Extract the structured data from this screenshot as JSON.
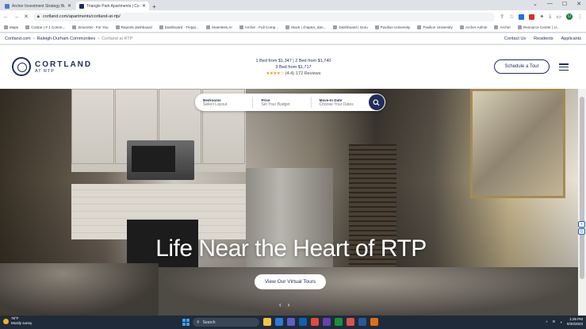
{
  "browser": {
    "tabs": [
      {
        "title": "Archer Investment Strategy Build",
        "fav": "#4a7bd0",
        "active": false
      },
      {
        "title": "Triangle Park Apartments | Cort",
        "fav": "#1f2d5c",
        "active": true
      }
    ],
    "new_tab_glyph": "+",
    "url": "cortland.com/apartments/cortland-at-rtp/",
    "profile_initial": "U"
  },
  "bookmarks": [
    "Maps",
    "CoStar | # 1 Comm...",
    "SiriusXM - For You",
    "Reports dashboard",
    "Dashboard - Treppi...",
    "Seamless.AI",
    "Archer - Full Comp...",
    "Slack | chapter_dan...",
    "Dashboard | Guru",
    "Pavilion University",
    "Pavilion University",
    "Archer Admin",
    "Archer",
    "Resource Center | U..."
  ],
  "site_nav": {
    "crumbs": [
      "Cortland.com",
      "Raleigh-Durham Communities",
      "Cortland at RTP"
    ],
    "links": [
      "Contact Us",
      "Residents",
      "Applicants"
    ]
  },
  "header": {
    "brand": "CORTLAND",
    "sub": "AT RTP",
    "pricing_line1": "1 Bed from $1,347  |  2 Bed from $1,740",
    "pricing_line2": "3 Bed from $1,717",
    "rating": "(4.4)",
    "reviews": "172 Reviews",
    "stars": "★★★★☆",
    "tour_button": "Schedule a Tour"
  },
  "search": {
    "fields": [
      {
        "label": "Bedrooms",
        "placeholder": "Select Layout"
      },
      {
        "label": "Price",
        "placeholder": "Set Your Budget"
      },
      {
        "label": "Move-In Date",
        "placeholder": "Choose Your Dates"
      }
    ]
  },
  "hero": {
    "headline": "Life Near the Heart of RTP",
    "tour_button": "View Our Virtual Tours",
    "prev": "‹",
    "next": "›"
  },
  "taskbar": {
    "temp": "78°F",
    "condition": "Mostly sunny",
    "search_placeholder": "Search",
    "time": "1:26 PM",
    "date": "8/30/2023",
    "app_colors": [
      "#f6c342",
      "#2d7ad6",
      "#5b5fc7",
      "#0a64ad",
      "#e24a3b",
      "#6a3fb2",
      "#1e8e3e",
      "#d9534f",
      "#2b579a",
      "#e06d16"
    ]
  },
  "colors": {
    "brand_navy": "#1f2d5c",
    "star": "#e0a100"
  }
}
